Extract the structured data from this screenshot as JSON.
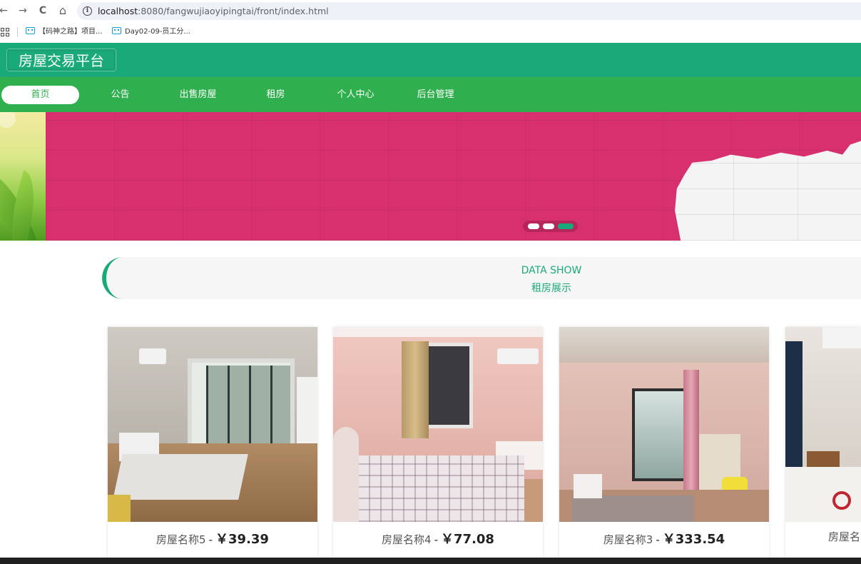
{
  "browser": {
    "back_icon": "←",
    "forward_icon": "→",
    "reload_icon": "C",
    "home_icon": "⌂",
    "url_host": "localhost",
    "url_path": ":8080/fangwujiaoyipingtai/front/index.html",
    "bookmarks": [
      {
        "label": "【码神之路】项目..."
      },
      {
        "label": "Day02-09-员工分..."
      }
    ]
  },
  "header": {
    "logo": "房屋交易平台"
  },
  "nav": {
    "items": [
      {
        "label": "首页",
        "active": true
      },
      {
        "label": "公告"
      },
      {
        "label": "出售房屋"
      },
      {
        "label": "租房"
      },
      {
        "label": "个人中心"
      },
      {
        "label": "后台管理"
      }
    ]
  },
  "banner": {
    "slide_count": 3,
    "active_slide": 3
  },
  "section": {
    "title_en": "DATA SHOW",
    "title_cn": "租房展示"
  },
  "houses": [
    {
      "name": "房屋名称5",
      "separator": "-",
      "price": "￥39.39"
    },
    {
      "name": "房屋名称4",
      "separator": "-",
      "price": "￥77.08"
    },
    {
      "name": "房屋名称3",
      "separator": "-",
      "price": "￥333.54"
    },
    {
      "name": "房屋名"
    }
  ],
  "colors": {
    "header_green": "#1aaa7a",
    "nav_green": "#2faf4d",
    "banner_pink": "#d8306e"
  }
}
